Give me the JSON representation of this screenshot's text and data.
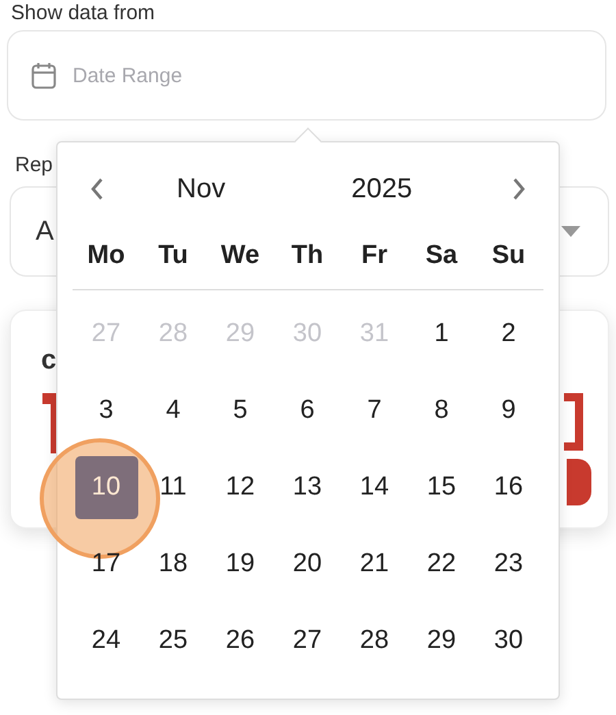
{
  "date_filter": {
    "label": "Show data from",
    "placeholder": "Date Range"
  },
  "report_select": {
    "label": "Rep",
    "value": "A"
  },
  "card": {
    "title": "c"
  },
  "calendar": {
    "month": "Nov",
    "year": "2025",
    "weekdays": [
      "Mo",
      "Tu",
      "We",
      "Th",
      "Fr",
      "Sa",
      "Su"
    ],
    "weeks": [
      [
        {
          "label": "27",
          "outside_month": true,
          "selected": false
        },
        {
          "label": "28",
          "outside_month": true,
          "selected": false
        },
        {
          "label": "29",
          "outside_month": true,
          "selected": false
        },
        {
          "label": "30",
          "outside_month": true,
          "selected": false
        },
        {
          "label": "31",
          "outside_month": true,
          "selected": false
        },
        {
          "label": "1",
          "outside_month": false,
          "selected": false
        },
        {
          "label": "2",
          "outside_month": false,
          "selected": false
        }
      ],
      [
        {
          "label": "3",
          "outside_month": false,
          "selected": false
        },
        {
          "label": "4",
          "outside_month": false,
          "selected": false
        },
        {
          "label": "5",
          "outside_month": false,
          "selected": false
        },
        {
          "label": "6",
          "outside_month": false,
          "selected": false
        },
        {
          "label": "7",
          "outside_month": false,
          "selected": false
        },
        {
          "label": "8",
          "outside_month": false,
          "selected": false
        },
        {
          "label": "9",
          "outside_month": false,
          "selected": false
        }
      ],
      [
        {
          "label": "10",
          "outside_month": false,
          "selected": true
        },
        {
          "label": "11",
          "outside_month": false,
          "selected": false
        },
        {
          "label": "12",
          "outside_month": false,
          "selected": false
        },
        {
          "label": "13",
          "outside_month": false,
          "selected": false
        },
        {
          "label": "14",
          "outside_month": false,
          "selected": false
        },
        {
          "label": "15",
          "outside_month": false,
          "selected": false
        },
        {
          "label": "16",
          "outside_month": false,
          "selected": false
        }
      ],
      [
        {
          "label": "17",
          "outside_month": false,
          "selected": false
        },
        {
          "label": "18",
          "outside_month": false,
          "selected": false
        },
        {
          "label": "19",
          "outside_month": false,
          "selected": false
        },
        {
          "label": "20",
          "outside_month": false,
          "selected": false
        },
        {
          "label": "21",
          "outside_month": false,
          "selected": false
        },
        {
          "label": "22",
          "outside_month": false,
          "selected": false
        },
        {
          "label": "23",
          "outside_month": false,
          "selected": false
        }
      ],
      [
        {
          "label": "24",
          "outside_month": false,
          "selected": false
        },
        {
          "label": "25",
          "outside_month": false,
          "selected": false
        },
        {
          "label": "26",
          "outside_month": false,
          "selected": false
        },
        {
          "label": "27",
          "outside_month": false,
          "selected": false
        },
        {
          "label": "28",
          "outside_month": false,
          "selected": false
        },
        {
          "label": "29",
          "outside_month": false,
          "selected": false
        },
        {
          "label": "30",
          "outside_month": false,
          "selected": false
        }
      ]
    ]
  }
}
